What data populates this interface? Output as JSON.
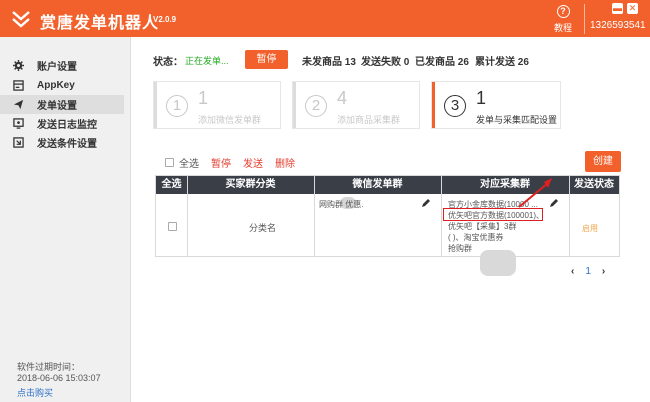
{
  "window": {
    "title": "赏唐发单机器人",
    "version": "V2.0.9",
    "tutorial_label": "教程",
    "phone": "13265935​41",
    "minimize_glyph": "▬",
    "close_glyph": "✕"
  },
  "sidebar": {
    "items": [
      {
        "label": "账户设置",
        "icon": "gear-icon"
      },
      {
        "label": "AppKey",
        "icon": "key-card-icon"
      },
      {
        "label": "发单设置",
        "icon": "send-icon"
      },
      {
        "label": "发送日志监控",
        "icon": "monitor-icon"
      },
      {
        "label": "发送条件设置",
        "icon": "settings-square-icon"
      }
    ],
    "active_index": 2,
    "expire_label": "软件过期时间：",
    "expire_time": "2018-06-06 15:03:07",
    "buy_link": "点击购买"
  },
  "status": {
    "label": "状态：",
    "value": "正在发单...",
    "pause_button": "暂停",
    "stats": [
      "未发商品 13",
      "发送失败 0",
      "已发商品 26",
      "累计发送 26"
    ]
  },
  "steps": [
    {
      "circle": "1",
      "count": "1",
      "desc": "添加微信发单群",
      "active": false
    },
    {
      "circle": "2",
      "count": "4",
      "desc": "添加商品采集群",
      "active": false
    },
    {
      "circle": "3",
      "count": "1",
      "desc": "发单与采集匹配设置",
      "active": true
    }
  ],
  "actions": {
    "select_all": "全选",
    "pause": "暂停",
    "send": "发送",
    "delete": "删除",
    "create_button": "创建"
  },
  "table": {
    "headers": [
      "全选",
      "买家群分类",
      "微信发单群",
      "对应采集群",
      "发送状态"
    ],
    "rows": [
      {
        "category": "分类名",
        "wechat_group": "网购群  优惠.",
        "collect_groups": [
          "官方小金库数据(10000 ...",
          "优矢吧官方数据(100001)、",
          "优矢吧【采集】3群",
          "(         )、淘宝优惠券",
          "抢购群"
        ],
        "status": "启用"
      }
    ]
  },
  "pagination": {
    "prev": "‹",
    "page": "1",
    "next": "›"
  },
  "colors": {
    "accent": "#f2612c",
    "table_header": "#3a3f47",
    "link": "#2a6fc9",
    "danger": "#e23c2c",
    "running": "#22aa22",
    "highlight_box": "#e02020"
  }
}
